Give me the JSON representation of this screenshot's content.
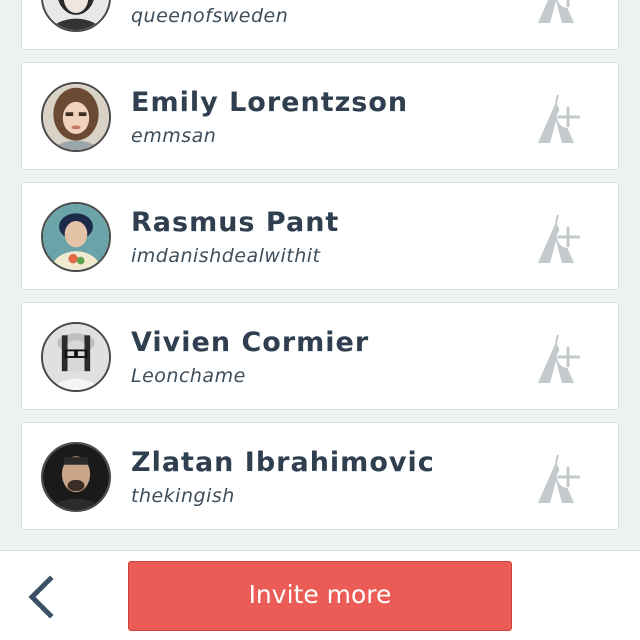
{
  "contacts": [
    {
      "name": "",
      "handle": "queenofsweden",
      "avatar_icon": "avatar-woman-icon",
      "add_icon": "tent-add-icon"
    },
    {
      "name": "Emily Lorentzson",
      "handle": "emmsan",
      "avatar_icon": "avatar-woman-icon",
      "add_icon": "tent-add-icon"
    },
    {
      "name": "Rasmus Pant",
      "handle": "imdanishdealwithit",
      "avatar_icon": "avatar-man-icon",
      "add_icon": "tent-add-icon"
    },
    {
      "name": "Vivien Cormier",
      "handle": "Leonchame",
      "avatar_icon": "avatar-man-glasses-icon",
      "add_icon": "tent-add-icon"
    },
    {
      "name": "Zlatan Ibrahimovic",
      "handle": "thekingish",
      "avatar_icon": "avatar-man-icon",
      "add_icon": "tent-add-icon"
    }
  ],
  "footer": {
    "back_icon": "chevron-left-icon",
    "invite_label": "Invite more"
  },
  "colors": {
    "background": "#eef1f2",
    "card": "#ffffff",
    "name_text": "#2f3f4f",
    "accent_red": "#ec5c56",
    "icon_grey": "#c4c9cc",
    "back_arrow": "#3a5066"
  }
}
